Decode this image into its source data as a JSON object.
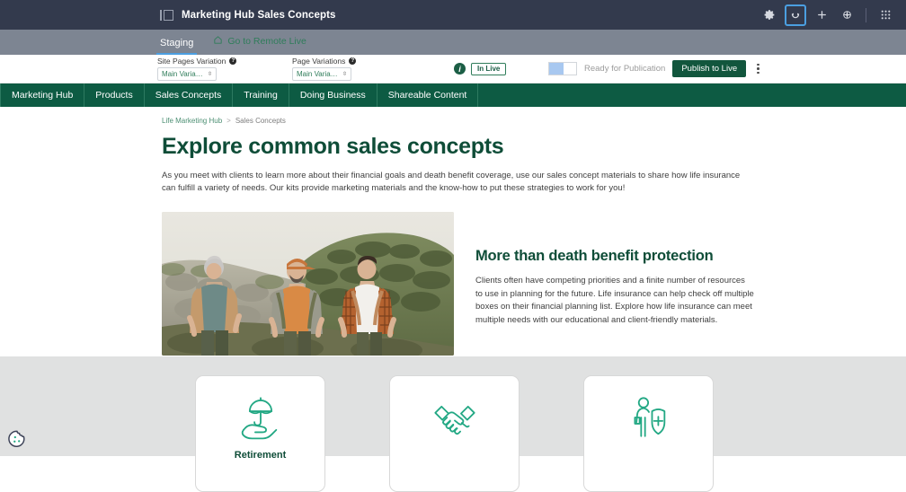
{
  "appbar": {
    "title": "Marketing Hub Sales Concepts",
    "panel_icon": "panel-toggle-icon",
    "icons": [
      {
        "name": "gear-icon",
        "glyph": "settings"
      },
      {
        "name": "smiley-icon",
        "glyph": "smiley"
      },
      {
        "name": "plus-icon",
        "glyph": "plus"
      },
      {
        "name": "globe-icon",
        "glyph": "globe"
      },
      {
        "name": "app-grid-icon",
        "glyph": "grid"
      }
    ],
    "bg_color": "#333a4d",
    "highlight_color": "#4b9fe1"
  },
  "staging": {
    "tab_label": "Staging",
    "remote_link": "Go to Remote Live",
    "home_icon": "home-icon",
    "bg_color": "#7d8592",
    "link_color": "#2f7d5a"
  },
  "variation_bar": {
    "site_pages_label": "Site Pages Variation",
    "site_pages_value": "Main Varia…",
    "page_variations_label": "Page Variations",
    "page_variations_value": "Main Varia…",
    "info_glyph": "?",
    "live_info_glyph": "i",
    "in_live_badge": "In Live",
    "toggle_state": "off",
    "ready_label": "Ready for Publication",
    "publish_label": "Publish to Live",
    "publish_color": "#12563d",
    "more_icon": "kebab-menu-icon"
  },
  "nav": {
    "items": [
      {
        "label": "Marketing Hub"
      },
      {
        "label": "Products"
      },
      {
        "label": "Sales Concepts"
      },
      {
        "label": "Training"
      },
      {
        "label": "Doing Business"
      },
      {
        "label": "Shareable Content"
      }
    ],
    "bg_color": "#0d5b43"
  },
  "breadcrumb": {
    "parent": "Life Marketing Hub",
    "separator": ">",
    "current": "Sales Concepts"
  },
  "main": {
    "title": "Explore common sales concepts",
    "intro": "As you meet with clients to learn more about their financial goals and death benefit coverage, use our sales concept materials to share how life insurance can fulfill a variety of needs. Our kits provide marketing materials and the know-how to put these strategies to work for you!",
    "hero_image_alt": "Three generations of men hiking together on a green hillside",
    "hero_heading": "More than death benefit protection",
    "hero_body": "Clients often have competing priorities and a finite number of resources to use in planning for the future. Life insurance can help check off multiple boxes on their financial planning list. Explore how life insurance can meet multiple needs with our educational and client-friendly materials.",
    "heading_color": "#0f4d38"
  },
  "cards": {
    "accent_color": "#23a884",
    "section_bg": "#e0e1e1",
    "items": [
      {
        "icon": "umbrella-in-hand-icon",
        "label": "Retirement"
      },
      {
        "icon": "handshake-icon",
        "label": ""
      },
      {
        "icon": "person-shield-plus-icon",
        "label": ""
      }
    ]
  },
  "cookie": {
    "icon": "cookie-consent-icon"
  }
}
